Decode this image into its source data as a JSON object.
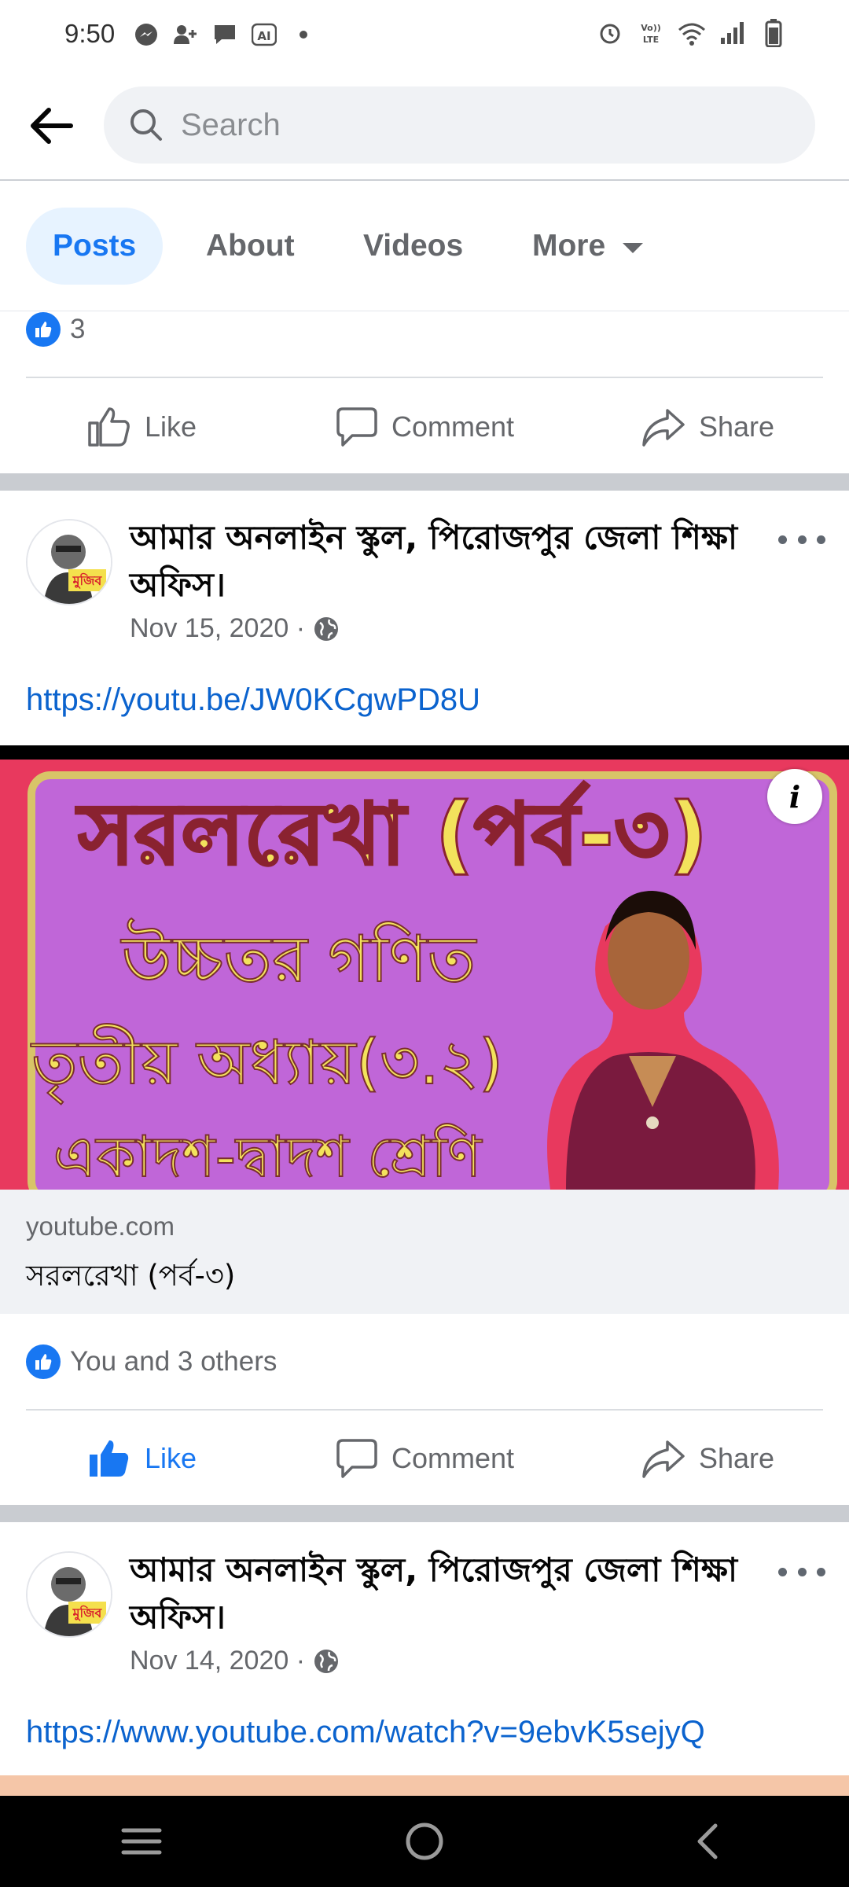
{
  "status_bar": {
    "time": "9:50",
    "left_icons": [
      "messenger-icon",
      "add-friend-icon",
      "chat-icon",
      "ai-icon",
      "dot-icon"
    ],
    "right_icons": [
      "alarm-icon",
      "volte-icon",
      "wifi-icon",
      "signal-icon",
      "battery-icon"
    ]
  },
  "search": {
    "placeholder": "Search"
  },
  "tabs": [
    {
      "label": "Posts",
      "active": true
    },
    {
      "label": "About",
      "active": false
    },
    {
      "label": "Videos",
      "active": false
    },
    {
      "label": "More",
      "active": false
    }
  ],
  "prev_post": {
    "reaction_count": "3",
    "actions": {
      "like": "Like",
      "comment": "Comment",
      "share": "Share"
    }
  },
  "post1": {
    "page_name": "আমার অনলাইন  স্কুল, পিরোজপুর জেলা শিক্ষা অফিস।",
    "date": "Nov 15, 2020 · ",
    "link": "https://youtu.be/JW0KCgwPD8U",
    "preview": {
      "image_title": "সরলরেখা (পর্ব-৩)",
      "image_line1": "উচ্চতর গণিত",
      "image_line2": "তৃতীয়  অধ্যায়(৩.২)",
      "image_line3": "একাদশ-দ্বাদশ শ্রেণি",
      "domain": "youtube.com",
      "title": "সরলরেখা (পর্ব-৩)"
    },
    "reactions_text": "You and 3 others",
    "actions": {
      "like": "Like",
      "comment": "Comment",
      "share": "Share"
    }
  },
  "post2": {
    "page_name": "আমার অনলাইন  স্কুল, পিরোজপুর জেলা শিক্ষা অফিস।",
    "date": "Nov 14, 2020 · ",
    "link": "https://www.youtube.com/watch?v=9ebvK5sejyQ"
  },
  "colors": {
    "accent": "#1877f2",
    "link": "#0b63ce",
    "preview_bg": "#c066d8",
    "preview_border": "#e8395e"
  }
}
